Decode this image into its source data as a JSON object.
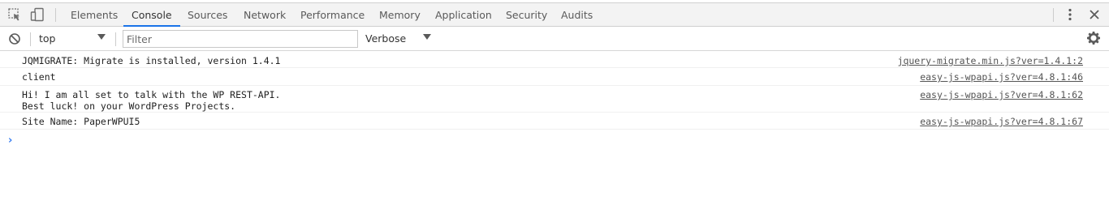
{
  "tabs": [
    {
      "label": "Elements"
    },
    {
      "label": "Console"
    },
    {
      "label": "Sources"
    },
    {
      "label": "Network"
    },
    {
      "label": "Performance"
    },
    {
      "label": "Memory"
    },
    {
      "label": "Application"
    },
    {
      "label": "Security"
    },
    {
      "label": "Audits"
    }
  ],
  "active_tab": "Console",
  "toolbar": {
    "context": "top",
    "filter_placeholder": "Filter",
    "level": "Verbose"
  },
  "icons": {
    "inspect": "element-picker-icon",
    "device": "device-toolbar-icon",
    "menu": "kebab-menu-icon",
    "close": "close-icon",
    "clear": "clear-console-icon",
    "settings": "gear-icon"
  },
  "colors": {
    "accent": "#1a73e8",
    "prompt": "#367cf1"
  },
  "messages": [
    {
      "text": "JQMIGRATE: Migrate is installed, version 1.4.1",
      "source": "jquery-migrate.min.js?ver=1.4.1:2"
    },
    {
      "text": "client",
      "source": "easy-js-wpapi.js?ver=4.8.1:46"
    },
    {
      "text": "Hi! I am all set to talk with the WP REST-API.\nBest luck! on your WordPress Projects.",
      "source": "easy-js-wpapi.js?ver=4.8.1:62"
    },
    {
      "text": "Site Name: PaperWPUI5",
      "source": "easy-js-wpapi.js?ver=4.8.1:67"
    }
  ],
  "prompt_symbol": "›"
}
